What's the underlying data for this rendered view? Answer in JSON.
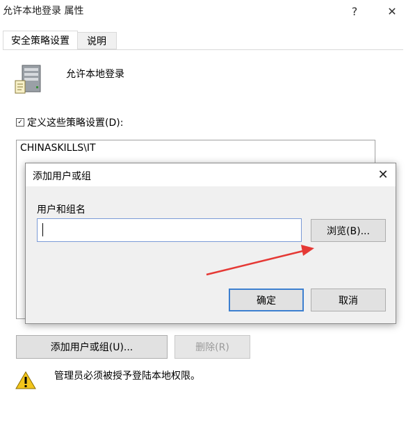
{
  "window": {
    "title": "允许本地登录 属性",
    "help_glyph": "?",
    "close_glyph": "✕"
  },
  "tabs": [
    {
      "label": "安全策略设置",
      "active": true
    },
    {
      "label": "说明",
      "active": false
    }
  ],
  "policy": {
    "name": "允许本地登录",
    "icon": "server-icon"
  },
  "define": {
    "checked": true,
    "check_glyph": "✓",
    "label": "定义这些策略设置(D):"
  },
  "list": {
    "items": [
      "CHINASKILLS\\IT"
    ]
  },
  "buttons": {
    "add_user_group": "添加用户或组(U)...",
    "remove": "删除(R)"
  },
  "warning": {
    "icon": "warning-icon",
    "text": "管理员必须被授予登陆本地权限。"
  },
  "dialog": {
    "title": "添加用户或组",
    "close_glyph": "✕",
    "field_label": "用户和组名",
    "field_value": "",
    "browse": "浏览(B)...",
    "ok": "确定",
    "cancel": "取消"
  },
  "colors": {
    "annotation_arrow": "#e53935",
    "input_border": "#7a9ad6"
  }
}
